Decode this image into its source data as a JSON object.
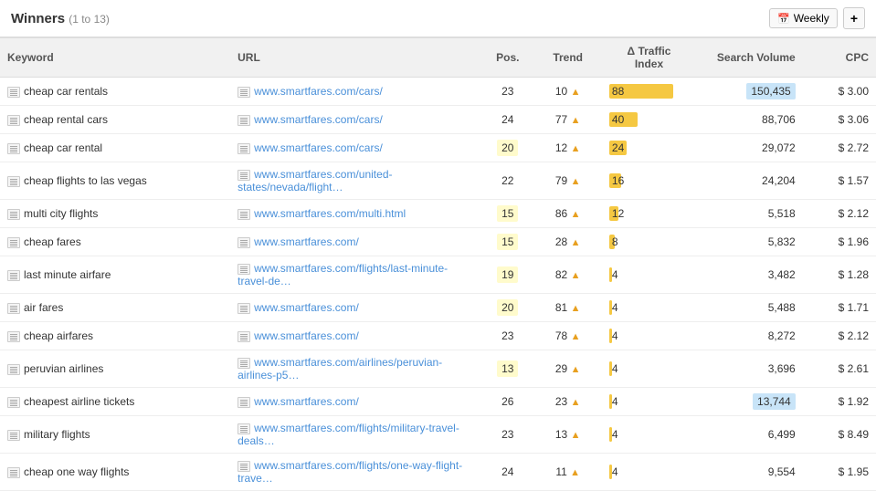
{
  "header": {
    "title": "Winners",
    "count": "(1 to 13)",
    "weekly_label": "Weekly",
    "add_label": "+"
  },
  "table": {
    "columns": [
      {
        "key": "keyword",
        "label": "Keyword"
      },
      {
        "key": "url",
        "label": "URL"
      },
      {
        "key": "pos",
        "label": "Pos.",
        "align": "center"
      },
      {
        "key": "trend",
        "label": "Trend",
        "align": "center"
      },
      {
        "key": "delta_traffic",
        "label": "Δ Traffic Index",
        "align": "center"
      },
      {
        "key": "search_volume",
        "label": "Search Volume",
        "align": "right"
      },
      {
        "key": "cpc",
        "label": "CPC",
        "align": "right"
      }
    ],
    "rows": [
      {
        "keyword": "cheap car rentals",
        "url": "www.smartfares.com/cars/",
        "pos": "23",
        "pos_highlight": false,
        "trend": "10",
        "trend_up": true,
        "delta_traffic": "88",
        "delta_color": "#f5c842",
        "delta_width": 90,
        "search_volume": "150,435",
        "sv_highlight": true,
        "cpc": "$ 3.00"
      },
      {
        "keyword": "cheap rental cars",
        "url": "www.smartfares.com/cars/",
        "pos": "24",
        "pos_highlight": false,
        "trend": "77",
        "trend_up": true,
        "delta_traffic": "40",
        "delta_color": "#f5c842",
        "delta_width": 50,
        "search_volume": "88,706",
        "sv_highlight": false,
        "cpc": "$ 3.06"
      },
      {
        "keyword": "cheap car rental",
        "url": "www.smartfares.com/cars/",
        "pos": "20",
        "pos_highlight": true,
        "trend": "12",
        "trend_up": true,
        "delta_traffic": "24",
        "delta_color": "#f5c842",
        "delta_width": 28,
        "search_volume": "29,072",
        "sv_highlight": false,
        "cpc": "$ 2.72"
      },
      {
        "keyword": "cheap flights to las vegas",
        "url": "www.smartfares.com/united-states/nevada/flight…",
        "pos": "22",
        "pos_highlight": false,
        "trend": "79",
        "trend_up": true,
        "delta_traffic": "16",
        "delta_color": "#f5c842",
        "delta_width": 20,
        "search_volume": "24,204",
        "sv_highlight": false,
        "cpc": "$ 1.57"
      },
      {
        "keyword": "multi city flights",
        "url": "www.smartfares.com/multi.html",
        "pos": "15",
        "pos_highlight": true,
        "trend": "86",
        "trend_up": true,
        "delta_traffic": "12",
        "delta_color": "#f5c842",
        "delta_width": 15,
        "search_volume": "5,518",
        "sv_highlight": false,
        "cpc": "$ 2.12"
      },
      {
        "keyword": "cheap fares",
        "url": "www.smartfares.com/",
        "pos": "15",
        "pos_highlight": true,
        "trend": "28",
        "trend_up": true,
        "delta_traffic": "8",
        "delta_color": "#f5c842",
        "delta_width": 10,
        "search_volume": "5,832",
        "sv_highlight": false,
        "cpc": "$ 1.96"
      },
      {
        "keyword": "last minute airfare",
        "url": "www.smartfares.com/flights/last-minute-travel-de…",
        "pos": "19",
        "pos_highlight": true,
        "trend": "82",
        "trend_up": true,
        "delta_traffic": "4",
        "delta_color": "#f5c842",
        "delta_width": 5,
        "search_volume": "3,482",
        "sv_highlight": false,
        "cpc": "$ 1.28"
      },
      {
        "keyword": "air fares",
        "url": "www.smartfares.com/",
        "pos": "20",
        "pos_highlight": true,
        "trend": "81",
        "trend_up": true,
        "delta_traffic": "4",
        "delta_color": "#f5c842",
        "delta_width": 5,
        "search_volume": "5,488",
        "sv_highlight": false,
        "cpc": "$ 1.71"
      },
      {
        "keyword": "cheap airfares",
        "url": "www.smartfares.com/",
        "pos": "23",
        "pos_highlight": false,
        "trend": "78",
        "trend_up": true,
        "delta_traffic": "4",
        "delta_color": "#f5c842",
        "delta_width": 5,
        "search_volume": "8,272",
        "sv_highlight": false,
        "cpc": "$ 2.12"
      },
      {
        "keyword": "peruvian airlines",
        "url": "www.smartfares.com/airlines/peruvian-airlines-p5…",
        "pos": "13",
        "pos_highlight": true,
        "trend": "29",
        "trend_up": true,
        "delta_traffic": "4",
        "delta_color": "#f5c842",
        "delta_width": 5,
        "search_volume": "3,696",
        "sv_highlight": false,
        "cpc": "$ 2.61"
      },
      {
        "keyword": "cheapest airline tickets",
        "url": "www.smartfares.com/",
        "pos": "26",
        "pos_highlight": false,
        "trend": "23",
        "trend_up": true,
        "delta_traffic": "4",
        "delta_color": "#f5c842",
        "delta_width": 5,
        "search_volume": "13,744",
        "sv_highlight": true,
        "cpc": "$ 1.92"
      },
      {
        "keyword": "military flights",
        "url": "www.smartfares.com/flights/military-travel-deals…",
        "pos": "23",
        "pos_highlight": false,
        "trend": "13",
        "trend_up": true,
        "delta_traffic": "4",
        "delta_color": "#f5c842",
        "delta_width": 5,
        "search_volume": "6,499",
        "sv_highlight": false,
        "cpc": "$ 8.49"
      },
      {
        "keyword": "cheap one way flights",
        "url": "www.smartfares.com/flights/one-way-flight-trave…",
        "pos": "24",
        "pos_highlight": false,
        "trend": "11",
        "trend_up": true,
        "delta_traffic": "4",
        "delta_color": "#f5c842",
        "delta_width": 5,
        "search_volume": "9,554",
        "sv_highlight": false,
        "cpc": "$ 1.95"
      }
    ]
  }
}
